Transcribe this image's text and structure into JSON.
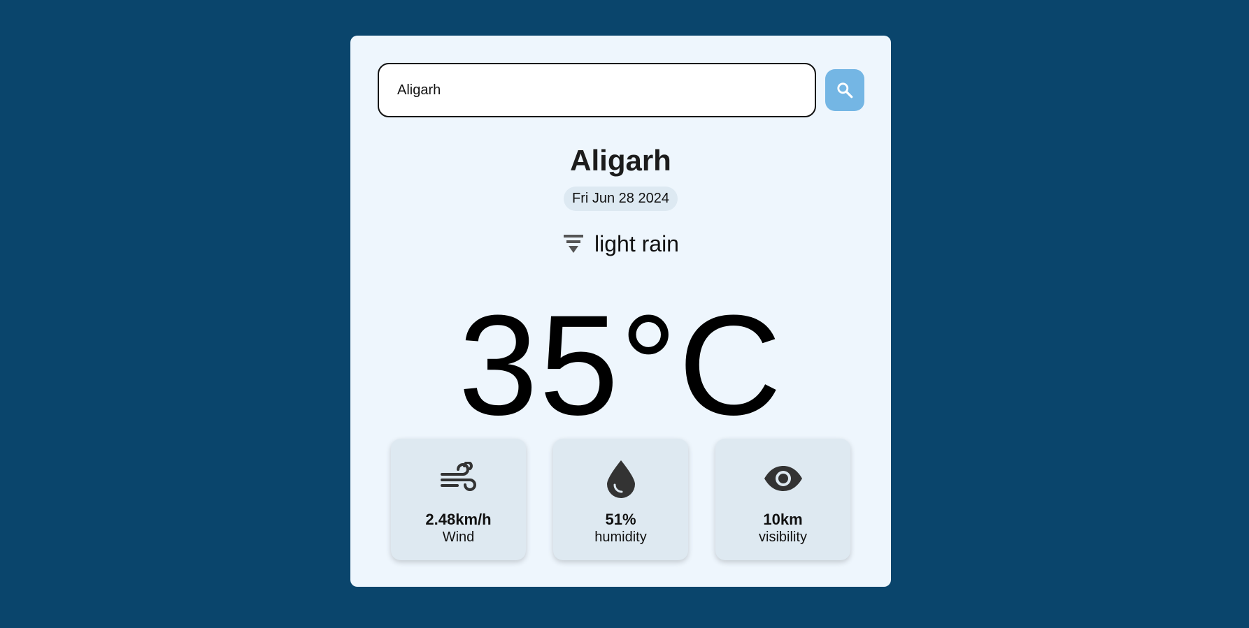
{
  "search": {
    "value": "Aligarh",
    "button_icon": "search-icon"
  },
  "weather": {
    "city": "Aligarh",
    "date": "Fri Jun 28 2024",
    "condition": "light rain",
    "condition_icon": "rain-icon",
    "temperature": "35°C"
  },
  "stats": [
    {
      "icon": "wind-icon",
      "value": "2.48km/h",
      "label": "Wind"
    },
    {
      "icon": "droplet-icon",
      "value": "51%",
      "label": "humidity"
    },
    {
      "icon": "eye-icon",
      "value": "10km",
      "label": "visibility"
    }
  ],
  "colors": {
    "background": "#0a456c",
    "card": "#eef6fd",
    "search_button": "#74b6e4",
    "stat_card": "#dee9f1"
  }
}
